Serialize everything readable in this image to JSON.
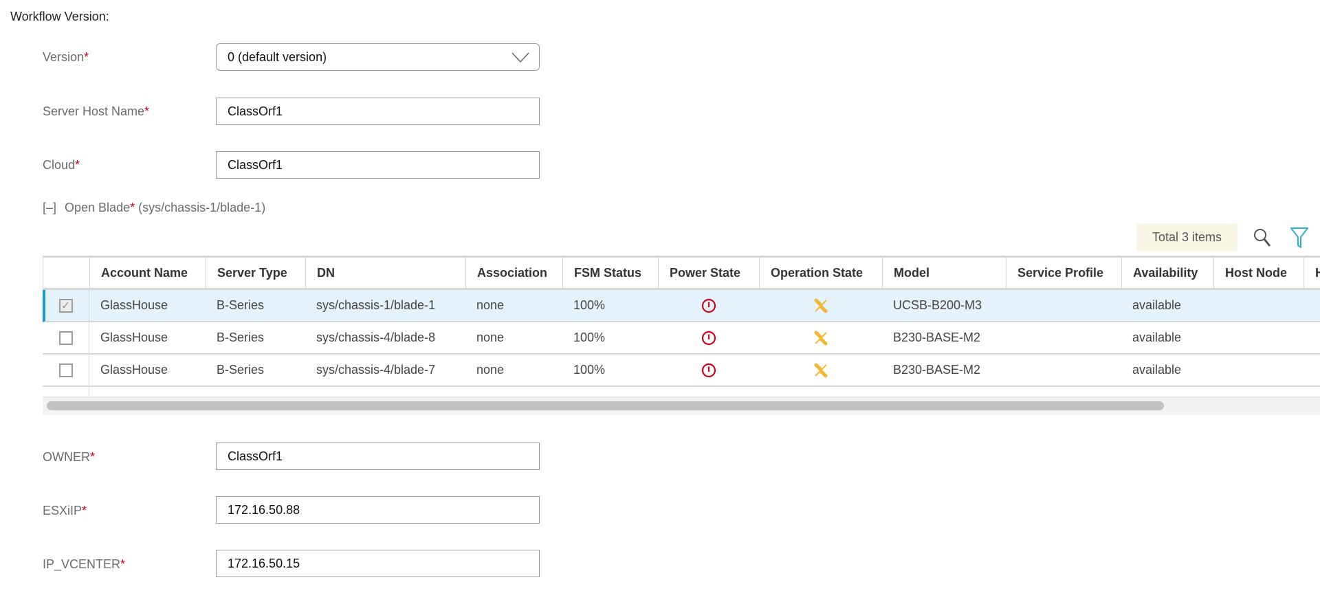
{
  "section_title": "Workflow Version:",
  "fields": {
    "version": {
      "label": "Version",
      "value": "0  (default version)"
    },
    "server_host_name": {
      "label": "Server Host Name",
      "value": "ClassOrf1"
    },
    "cloud": {
      "label": "Cloud",
      "value": "ClassOrf1"
    },
    "owner": {
      "label": "OWNER",
      "value": "ClassOrf1"
    },
    "esxiip": {
      "label": "ESXiIP",
      "value": "172.16.50.88"
    },
    "ip_vcenter": {
      "label": "IP_VCENTER",
      "value": "172.16.50.15"
    }
  },
  "required_mark": "*",
  "open_blade": {
    "toggle": "[–]",
    "label": "Open Blade",
    "selection": "(sys/chassis-1/blade-1)"
  },
  "table": {
    "total": "Total 3 items",
    "columns": [
      "Account Name",
      "Server Type",
      "DN",
      "Association",
      "FSM Status",
      "Power State",
      "Operation State",
      "Model",
      "Service Profile",
      "Availability",
      "Host Node",
      "H"
    ],
    "rows": [
      {
        "checked": true,
        "account": "GlassHouse",
        "type": "B-Series",
        "dn": "sys/chassis-1/blade-1",
        "assoc": "none",
        "fsm": "100%",
        "power": "power-off-icon",
        "op": "unassociated-icon",
        "model": "UCSB-B200-M3",
        "profile": "",
        "avail": "available",
        "host": ""
      },
      {
        "checked": false,
        "account": "GlassHouse",
        "type": "B-Series",
        "dn": "sys/chassis-4/blade-8",
        "assoc": "none",
        "fsm": "100%",
        "power": "power-off-icon",
        "op": "unassociated-icon",
        "model": "B230-BASE-M2",
        "profile": "",
        "avail": "available",
        "host": ""
      },
      {
        "checked": false,
        "account": "GlassHouse",
        "type": "B-Series",
        "dn": "sys/chassis-4/blade-7",
        "assoc": "none",
        "fsm": "100%",
        "power": "power-off-icon",
        "op": "unassociated-icon",
        "model": "B230-BASE-M2",
        "profile": "",
        "avail": "available",
        "host": ""
      }
    ]
  },
  "colors": {
    "required": "#d0021b",
    "selected_row": "#e4f3fb",
    "accent": "#1a9bd7",
    "power": "#d0021b",
    "operation": "#f5b731",
    "filter": "#2bb3c9"
  }
}
